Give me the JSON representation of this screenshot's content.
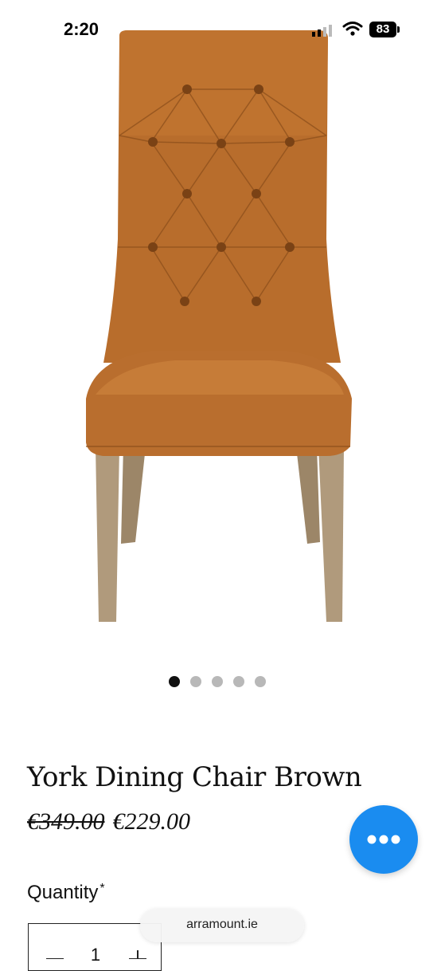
{
  "status_bar": {
    "time": "2:20",
    "battery": "83"
  },
  "product": {
    "title": "York Dining Chair Brown",
    "price_original": "€349.00",
    "price_sale": "€229.00",
    "image_alt": "chair-photo"
  },
  "carousel": {
    "count": 5,
    "active_index": 0
  },
  "quantity": {
    "label": "Quantity",
    "required_mark": "*",
    "value": "1"
  },
  "browser": {
    "url": "arramount.ie"
  },
  "colors": {
    "chat_button": "#1a8cf0",
    "upholstery": "#b86d2c",
    "legs": "#b09a7c"
  },
  "icons": [
    "signal-icon",
    "wifi-icon",
    "battery-icon",
    "chat-more-icon",
    "minus-icon",
    "plus-icon"
  ]
}
